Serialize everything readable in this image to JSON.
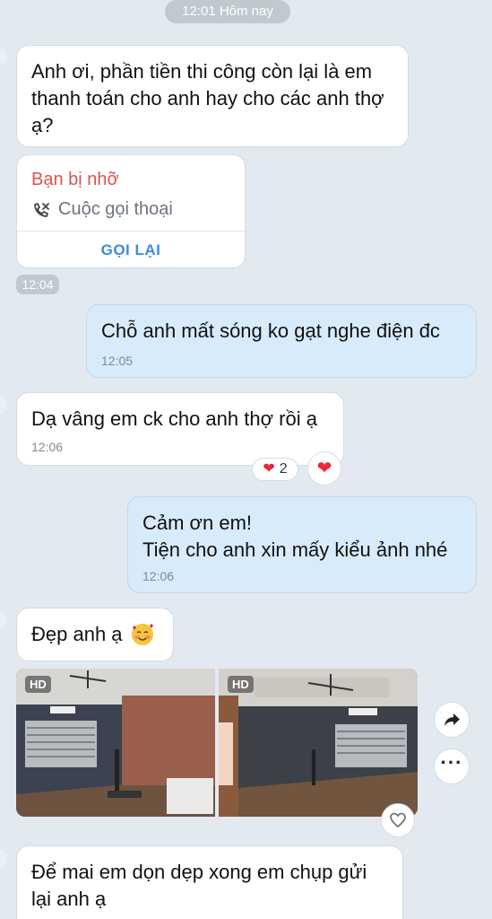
{
  "date_chip": "12:01 Hôm nay",
  "messages": {
    "m1": {
      "text": "Anh ơi, phần tiền thi công còn lại là em thanh toán cho anh hay cho các anh thợ ạ?"
    },
    "missed_call": {
      "title": "Bạn bị nhỡ",
      "subtitle": "Cuộc gọi thoại",
      "callback": "GỌI LẠI",
      "time": "12:04"
    },
    "m2": {
      "text": "Chỗ anh mất sóng ko gạt nghe điện đc",
      "time": "12:05"
    },
    "m3": {
      "text": "Dạ vâng em ck cho anh thợ rồi ạ",
      "time": "12:06",
      "reaction_count": "2"
    },
    "m4": {
      "line1": "Cảm ơn em!",
      "line2": "Tiện cho anh xin mấy kiểu ảnh nhé",
      "time": "12:06"
    },
    "m5": {
      "text": "Đẹp anh ạ"
    },
    "photos": {
      "badge1": "HD",
      "badge2": "HD"
    },
    "m6": {
      "text": "Để mai em dọn dẹp xong em chụp gửi lại anh ạ"
    }
  },
  "icons": {
    "missed": "missed-call-icon",
    "heart": "heart-icon",
    "share": "share-icon",
    "more": "more-icon",
    "emoji": "smiling-face-with-hearts-emoji"
  },
  "colors": {
    "missed_red": "#d9534f",
    "link_blue": "#3a8ddc",
    "mine_bubble": "#d7ebfa",
    "heart": "#e8283c"
  }
}
